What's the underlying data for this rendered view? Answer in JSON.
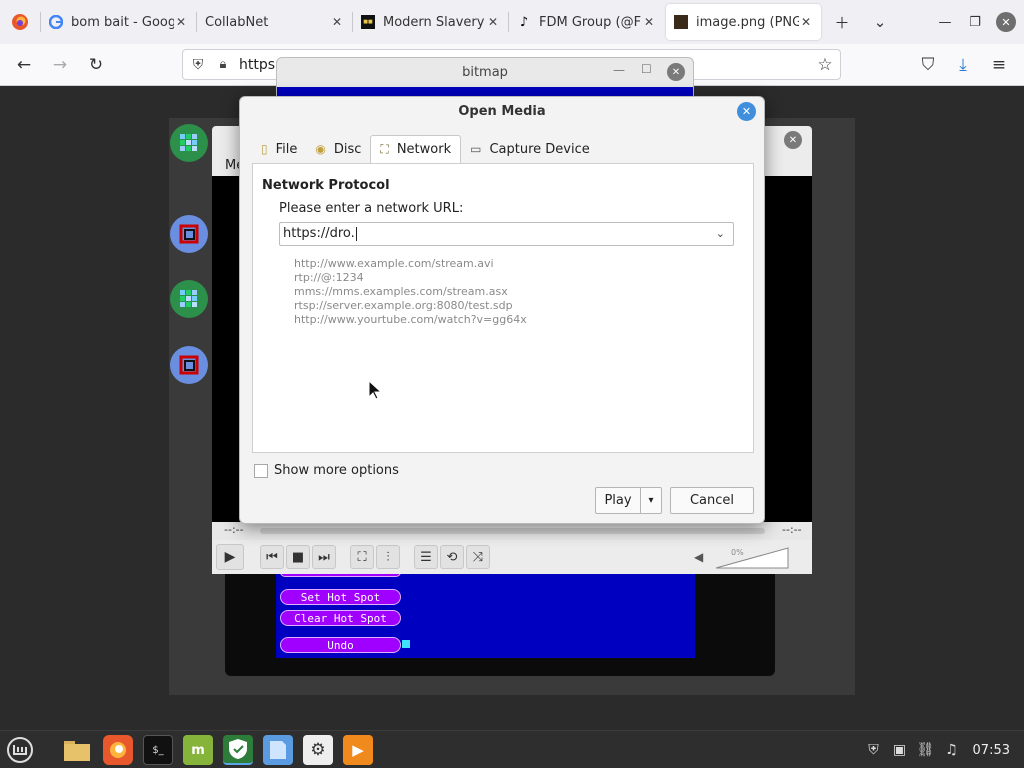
{
  "browser": {
    "tabs": [
      {
        "title": "bom bait - Goog",
        "favicon": "google-icon"
      },
      {
        "title": "CollabNet",
        "favicon": ""
      },
      {
        "title": "Modern Slavery",
        "favicon": "site-icon"
      },
      {
        "title": "FDM Group (@F",
        "favicon": "tiktok-icon"
      },
      {
        "title": "image.png (PNG",
        "favicon": "image-icon"
      }
    ],
    "url": "https"
  },
  "bitmap_window": {
    "title": "bitmap",
    "buttons": [
      "Set Hot Spot",
      "Clear Hot Spot",
      "Undo"
    ]
  },
  "vlc": {
    "menu_partial": "Me",
    "time_left": "--:--",
    "time_right": "--:--",
    "volume": "0%"
  },
  "dialog": {
    "title": "Open Media",
    "tabs": [
      {
        "label": "File",
        "icon": "file-icon"
      },
      {
        "label": "Disc",
        "icon": "disc-icon"
      },
      {
        "label": "Network",
        "icon": "network-icon"
      },
      {
        "label": "Capture Device",
        "icon": "capture-icon"
      }
    ],
    "active_tab": "Network",
    "section_heading": "Network Protocol",
    "url_label": "Please enter a network URL:",
    "url_value": "https://dro.",
    "examples": [
      "http://www.example.com/stream.avi",
      "rtp://@:1234",
      "mms://mms.examples.com/stream.asx",
      "rtsp://server.example.org:8080/test.sdp",
      "http://www.yourtube.com/watch?v=gg64x"
    ],
    "more_options": "Show more options",
    "play": "Play",
    "cancel": "Cancel"
  },
  "taskbar": {
    "clock": "07:53"
  },
  "colors": {
    "dialog_close": "#3f8fdd",
    "bitmap_blue": "#0000c0",
    "bitmap_button": "#a000ff",
    "taskbar": "#2e2e2e"
  }
}
